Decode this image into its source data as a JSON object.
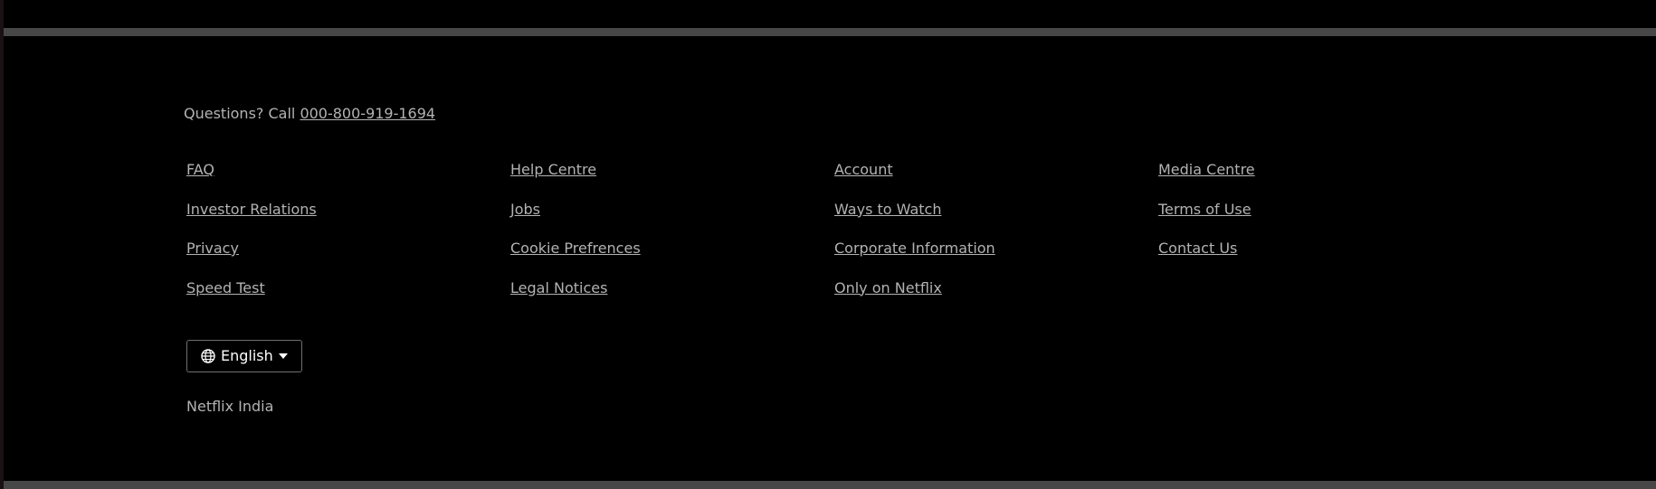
{
  "footer": {
    "questions_prefix": "Questions? Call ",
    "phone": "000-800-919-1694",
    "links": [
      "FAQ",
      "Help Centre",
      "Account",
      "Media Centre",
      "Investor Relations",
      "Jobs",
      "Ways to Watch",
      "Terms of Use",
      "Privacy",
      "Cookie Prefrences",
      "Corporate Information",
      "Contact Us",
      "Speed Test",
      "Legal Notices",
      "Only on Netflix"
    ],
    "language": {
      "selected": "English",
      "icon": "globe-icon",
      "caret_icon": "caret-down-icon"
    },
    "country": "Netflix India"
  },
  "colors": {
    "background": "#000000",
    "divider": "#474747",
    "link_text": "#b3b3b3",
    "select_border": "#6f6f6f",
    "select_text": "#ffffff"
  }
}
